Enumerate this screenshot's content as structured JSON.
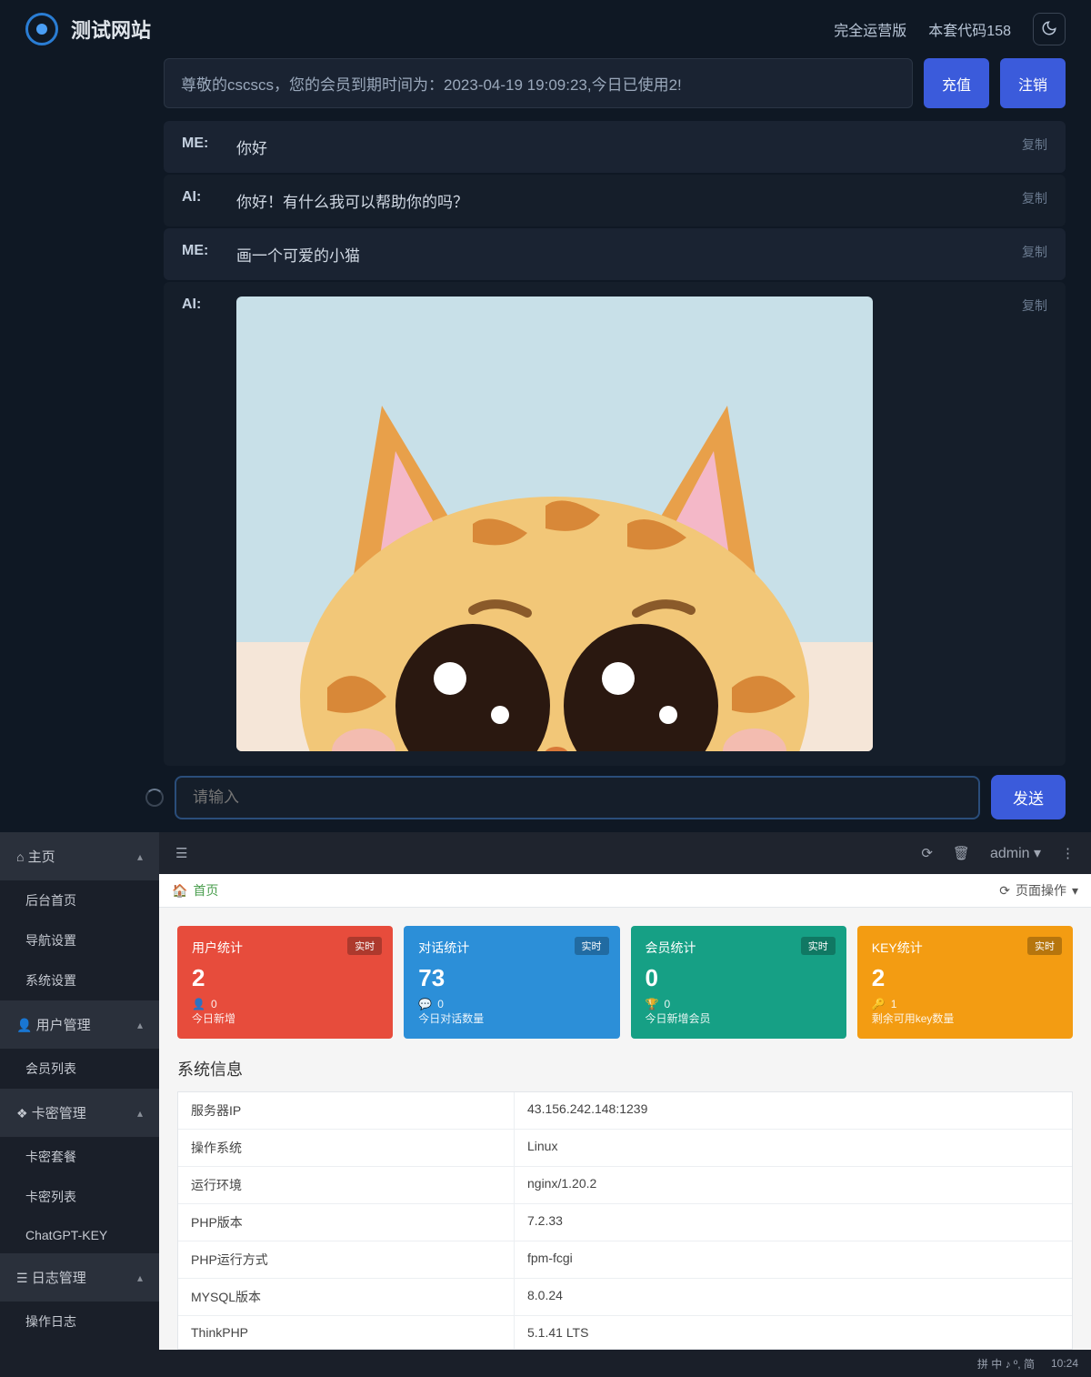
{
  "header": {
    "site_name": "测试网站",
    "link_full": "完全运营版",
    "link_code": "本套代码158"
  },
  "info": {
    "text": "尊敬的cscscs，您的会员到期时间为：2023-04-19 19:09:23,今日已使用2!",
    "btn_recharge": "充值",
    "btn_logout": "注销"
  },
  "messages": [
    {
      "role": "ME:",
      "text": "你好",
      "copy": "复制"
    },
    {
      "role": "AI:",
      "text": "你好！有什么我可以帮助你的吗？",
      "copy": "复制"
    },
    {
      "role": "ME:",
      "text": "画一个可爱的小猫",
      "copy": "复制"
    },
    {
      "role": "AI:",
      "text": "",
      "copy": "复制",
      "image": true
    }
  ],
  "input": {
    "placeholder": "请输入",
    "send": "发送"
  },
  "admin": {
    "top": {
      "user": "admin"
    },
    "sidebar": {
      "home": "主页",
      "home_items": [
        "后台首页",
        "导航设置",
        "系统设置"
      ],
      "user_mgmt": "用户管理",
      "user_items": [
        "会员列表"
      ],
      "card_mgmt": "卡密管理",
      "card_items": [
        "卡密套餐",
        "卡密列表",
        "ChatGPT-KEY"
      ],
      "log_mgmt": "日志管理",
      "log_items": [
        "操作日志"
      ]
    },
    "crumb": "首页",
    "page_ops": "页面操作",
    "cards": [
      {
        "title": "用户统计",
        "val": "2",
        "sub_icon": "👤",
        "sub_val": "0",
        "sub2": "今日新增",
        "badge": "实时"
      },
      {
        "title": "对话统计",
        "val": "73",
        "sub_icon": "💬",
        "sub_val": "0",
        "sub2": "今日对话数量",
        "badge": "实时"
      },
      {
        "title": "会员统计",
        "val": "0",
        "sub_icon": "🏆",
        "sub_val": "0",
        "sub2": "今日新增会员",
        "badge": "实时"
      },
      {
        "title": "KEY统计",
        "val": "2",
        "sub_icon": "🔑",
        "sub_val": "1",
        "sub2": "剩余可用key数量",
        "badge": "实时"
      }
    ],
    "sys_title": "系统信息",
    "sys": [
      {
        "k": "服务器IP",
        "v": "43.156.242.148:1239"
      },
      {
        "k": "操作系统",
        "v": "Linux"
      },
      {
        "k": "运行环境",
        "v": "nginx/1.20.2"
      },
      {
        "k": "PHP版本",
        "v": "7.2.33"
      },
      {
        "k": "PHP运行方式",
        "v": "fpm-fcgi"
      },
      {
        "k": "MYSQL版本",
        "v": "8.0.24"
      },
      {
        "k": "ThinkPHP",
        "v": "5.1.41 LTS"
      }
    ]
  },
  "taskbar": {
    "ime": "拼 中 ♪ º, 简",
    "time": "10:24"
  }
}
